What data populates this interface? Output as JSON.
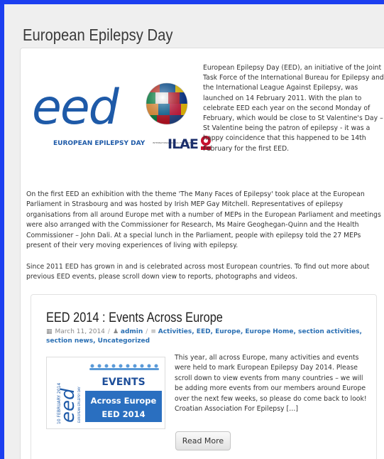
{
  "page": {
    "title": "European Epilepsy Day"
  },
  "hero": {
    "logo_text": "eed",
    "logo_tagline": "EUROPEAN EPILEPSY DAY",
    "partner_logo_text": "ILAE",
    "partner_small_text": "INTERNATIONAL BUREAU FOR EPILEPSY",
    "colors": {
      "brand_blue": "#1e5aa8",
      "ilae_red": "#c8102e"
    }
  },
  "intro_text": "European Epilepsy Day (EED), an initiative of the Joint Task Force of the International Bureau for Epilepsy and the International League Against Epilepsy, was launched on 14 February 2011. With the plan to celebrate EED each year on the second Monday of February, which would be close to St Valentine's Day – St Valentine being the patron of epilepsy - it was a happy coincidence that this happened to be 14th February for the first EED.",
  "paragraphs": [
    "On the first EED an exhibition with the theme 'The Many Faces of Epilepsy' took place at the European Parliament in Strasbourg and was hosted by Irish MEP Gay Mitchell. Representatives of epilepsy organisations from all around Europe met with a number of MEPs in the European Parliament and meetings were also arranged with the Commissioner for Research, Ms Maire Geoghegan-Quinn and the Health Commissioner – John Dali. At a special lunch in the Parliament, people with epilepsy told the 27 MEPs present of their very moving experiences of living with epilepsy.",
    "Since 2011 EED has grown in and is celebrated across most European countries. To find out more about previous EED events, please scroll down view to reports, photographs and videos."
  ],
  "post": {
    "title": "EED 2014 : Events Across Europe",
    "date": "March 11, 2014",
    "date_icon": "calendar-icon",
    "author": "admin",
    "author_icon": "user-icon",
    "categories_icon": "list-icon",
    "categories": "Activities, EED, Europe, Europe Home, section activities, section news, Uncategorized",
    "image": {
      "side_text": "10 FEBRUARY 2014",
      "side_logo": "eed",
      "side_tagline": "EUROPEAN EPILEPSY DAY",
      "top_label": "EVENTS",
      "mid_label": "Across Europe",
      "bottom_label": "EED 2014"
    },
    "excerpt": "This year, all across Europe, many activities and events were held to mark European Epilepsy Day 2014. Please scroll down to view events from many countries – we will be adding more events from our members around Europe over the next few weeks, so please do come back to look! Croatian Association For Epilepsy […]",
    "read_more_label": "Read More"
  }
}
